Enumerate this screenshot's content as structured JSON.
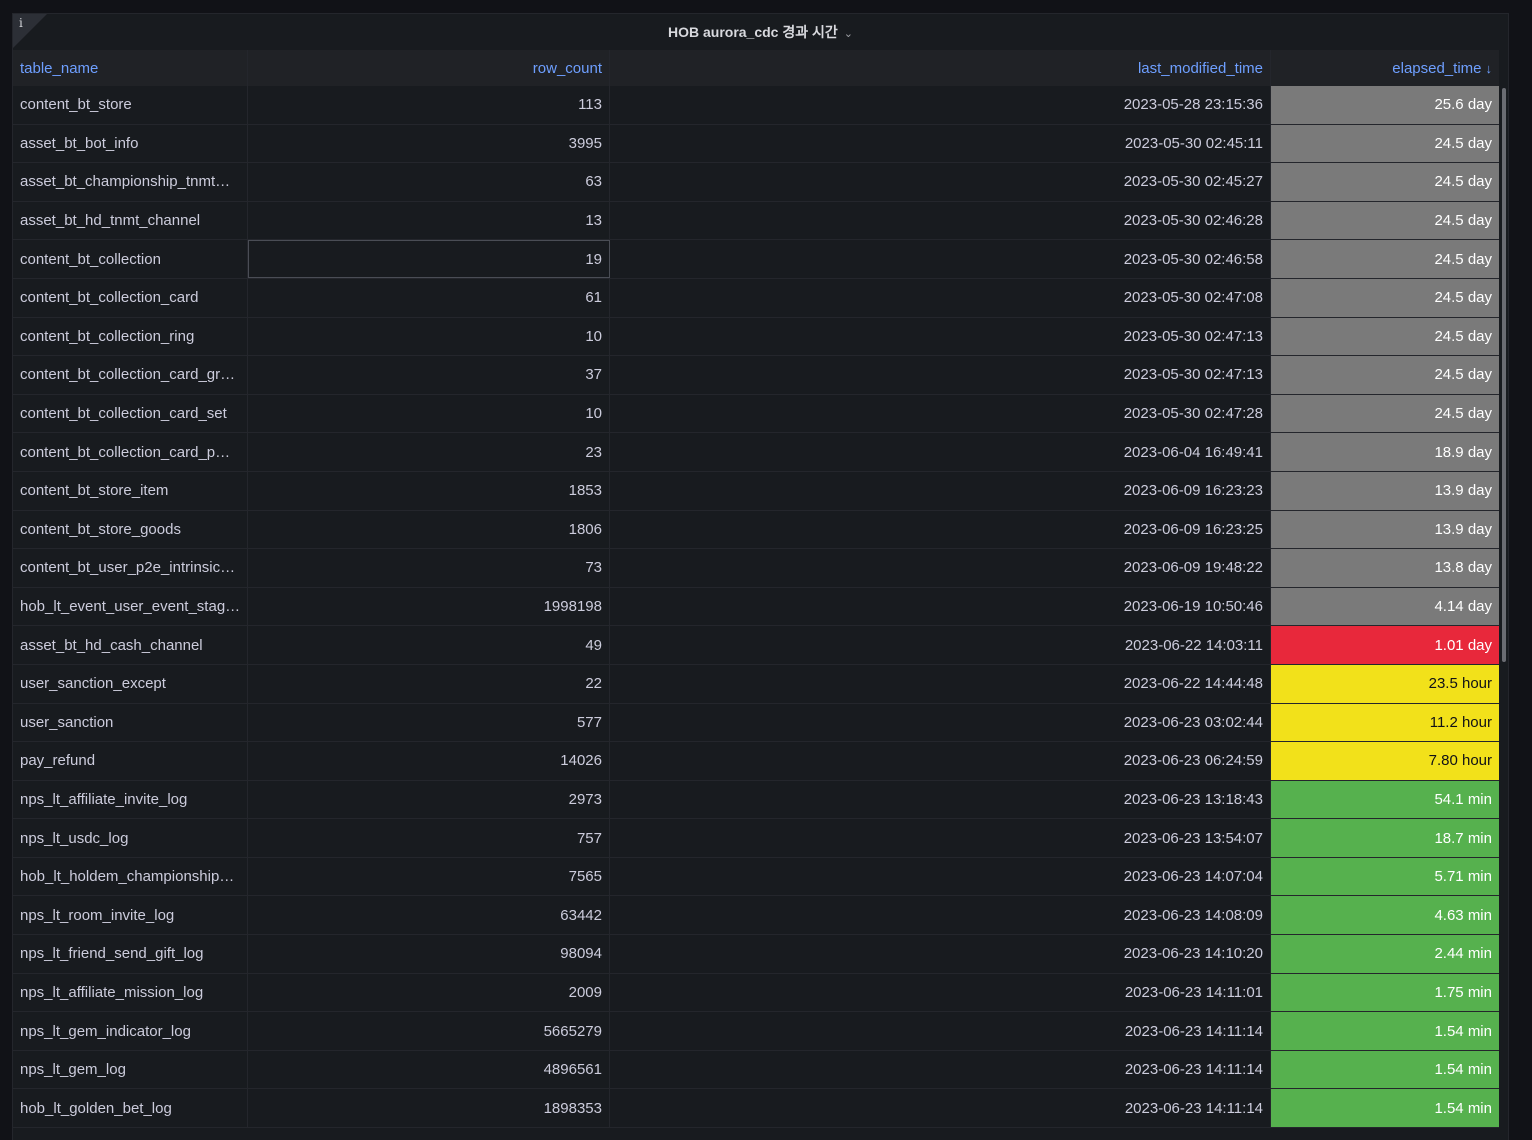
{
  "panel": {
    "title": "HOB aurora_cdc 경과 시간",
    "info_icon": "i"
  },
  "columns": {
    "table_name": "table_name",
    "row_count": "row_count",
    "last_modified_time": "last_modified_time",
    "elapsed_time": "elapsed_time",
    "sort_indicator": "↓"
  },
  "status_colors": {
    "gray": "#7a7a7a",
    "red": "#e8283b",
    "yellow": "#f2e11a",
    "green": "#56b14e"
  },
  "rows": [
    {
      "table_name": "content_bt_store",
      "row_count": "113",
      "last_modified_time": "2023-05-28 23:15:36",
      "elapsed_time": "25.6 day",
      "status": "gray"
    },
    {
      "table_name": "asset_bt_bot_info",
      "row_count": "3995",
      "last_modified_time": "2023-05-30 02:45:11",
      "elapsed_time": "24.5 day",
      "status": "gray"
    },
    {
      "table_name": "asset_bt_championship_tnmt…",
      "row_count": "63",
      "last_modified_time": "2023-05-30 02:45:27",
      "elapsed_time": "24.5 day",
      "status": "gray"
    },
    {
      "table_name": "asset_bt_hd_tnmt_channel",
      "row_count": "13",
      "last_modified_time": "2023-05-30 02:46:28",
      "elapsed_time": "24.5 day",
      "status": "gray"
    },
    {
      "table_name": "content_bt_collection",
      "row_count": "19",
      "last_modified_time": "2023-05-30 02:46:58",
      "elapsed_time": "24.5 day",
      "status": "gray"
    },
    {
      "table_name": "content_bt_collection_card",
      "row_count": "61",
      "last_modified_time": "2023-05-30 02:47:08",
      "elapsed_time": "24.5 day",
      "status": "gray"
    },
    {
      "table_name": "content_bt_collection_ring",
      "row_count": "10",
      "last_modified_time": "2023-05-30 02:47:13",
      "elapsed_time": "24.5 day",
      "status": "gray"
    },
    {
      "table_name": "content_bt_collection_card_gr…",
      "row_count": "37",
      "last_modified_time": "2023-05-30 02:47:13",
      "elapsed_time": "24.5 day",
      "status": "gray"
    },
    {
      "table_name": "content_bt_collection_card_set",
      "row_count": "10",
      "last_modified_time": "2023-05-30 02:47:28",
      "elapsed_time": "24.5 day",
      "status": "gray"
    },
    {
      "table_name": "content_bt_collection_card_p…",
      "row_count": "23",
      "last_modified_time": "2023-06-04 16:49:41",
      "elapsed_time": "18.9 day",
      "status": "gray"
    },
    {
      "table_name": "content_bt_store_item",
      "row_count": "1853",
      "last_modified_time": "2023-06-09 16:23:23",
      "elapsed_time": "13.9 day",
      "status": "gray"
    },
    {
      "table_name": "content_bt_store_goods",
      "row_count": "1806",
      "last_modified_time": "2023-06-09 16:23:25",
      "elapsed_time": "13.9 day",
      "status": "gray"
    },
    {
      "table_name": "content_bt_user_p2e_intrinsic…",
      "row_count": "73",
      "last_modified_time": "2023-06-09 19:48:22",
      "elapsed_time": "13.8 day",
      "status": "gray"
    },
    {
      "table_name": "hob_lt_event_user_event_stag…",
      "row_count": "1998198",
      "last_modified_time": "2023-06-19 10:50:46",
      "elapsed_time": "4.14 day",
      "status": "gray"
    },
    {
      "table_name": "asset_bt_hd_cash_channel",
      "row_count": "49",
      "last_modified_time": "2023-06-22 14:03:11",
      "elapsed_time": "1.01 day",
      "status": "red"
    },
    {
      "table_name": "user_sanction_except",
      "row_count": "22",
      "last_modified_time": "2023-06-22 14:44:48",
      "elapsed_time": "23.5 hour",
      "status": "yellow"
    },
    {
      "table_name": "user_sanction",
      "row_count": "577",
      "last_modified_time": "2023-06-23 03:02:44",
      "elapsed_time": "11.2 hour",
      "status": "yellow"
    },
    {
      "table_name": "pay_refund",
      "row_count": "14026",
      "last_modified_time": "2023-06-23 06:24:59",
      "elapsed_time": "7.80 hour",
      "status": "yellow"
    },
    {
      "table_name": "nps_lt_affiliate_invite_log",
      "row_count": "2973",
      "last_modified_time": "2023-06-23 13:18:43",
      "elapsed_time": "54.1 min",
      "status": "green"
    },
    {
      "table_name": "nps_lt_usdc_log",
      "row_count": "757",
      "last_modified_time": "2023-06-23 13:54:07",
      "elapsed_time": "18.7 min",
      "status": "green"
    },
    {
      "table_name": "hob_lt_holdem_championship…",
      "row_count": "7565",
      "last_modified_time": "2023-06-23 14:07:04",
      "elapsed_time": "5.71 min",
      "status": "green"
    },
    {
      "table_name": "nps_lt_room_invite_log",
      "row_count": "63442",
      "last_modified_time": "2023-06-23 14:08:09",
      "elapsed_time": "4.63 min",
      "status": "green"
    },
    {
      "table_name": "nps_lt_friend_send_gift_log",
      "row_count": "98094",
      "last_modified_time": "2023-06-23 14:10:20",
      "elapsed_time": "2.44 min",
      "status": "green"
    },
    {
      "table_name": "nps_lt_affiliate_mission_log",
      "row_count": "2009",
      "last_modified_time": "2023-06-23 14:11:01",
      "elapsed_time": "1.75 min",
      "status": "green"
    },
    {
      "table_name": "nps_lt_gem_indicator_log",
      "row_count": "5665279",
      "last_modified_time": "2023-06-23 14:11:14",
      "elapsed_time": "1.54 min",
      "status": "green"
    },
    {
      "table_name": "nps_lt_gem_log",
      "row_count": "4896561",
      "last_modified_time": "2023-06-23 14:11:14",
      "elapsed_time": "1.54 min",
      "status": "green"
    },
    {
      "table_name": "hob_lt_golden_bet_log",
      "row_count": "1898353",
      "last_modified_time": "2023-06-23 14:11:14",
      "elapsed_time": "1.54 min",
      "status": "green"
    }
  ]
}
